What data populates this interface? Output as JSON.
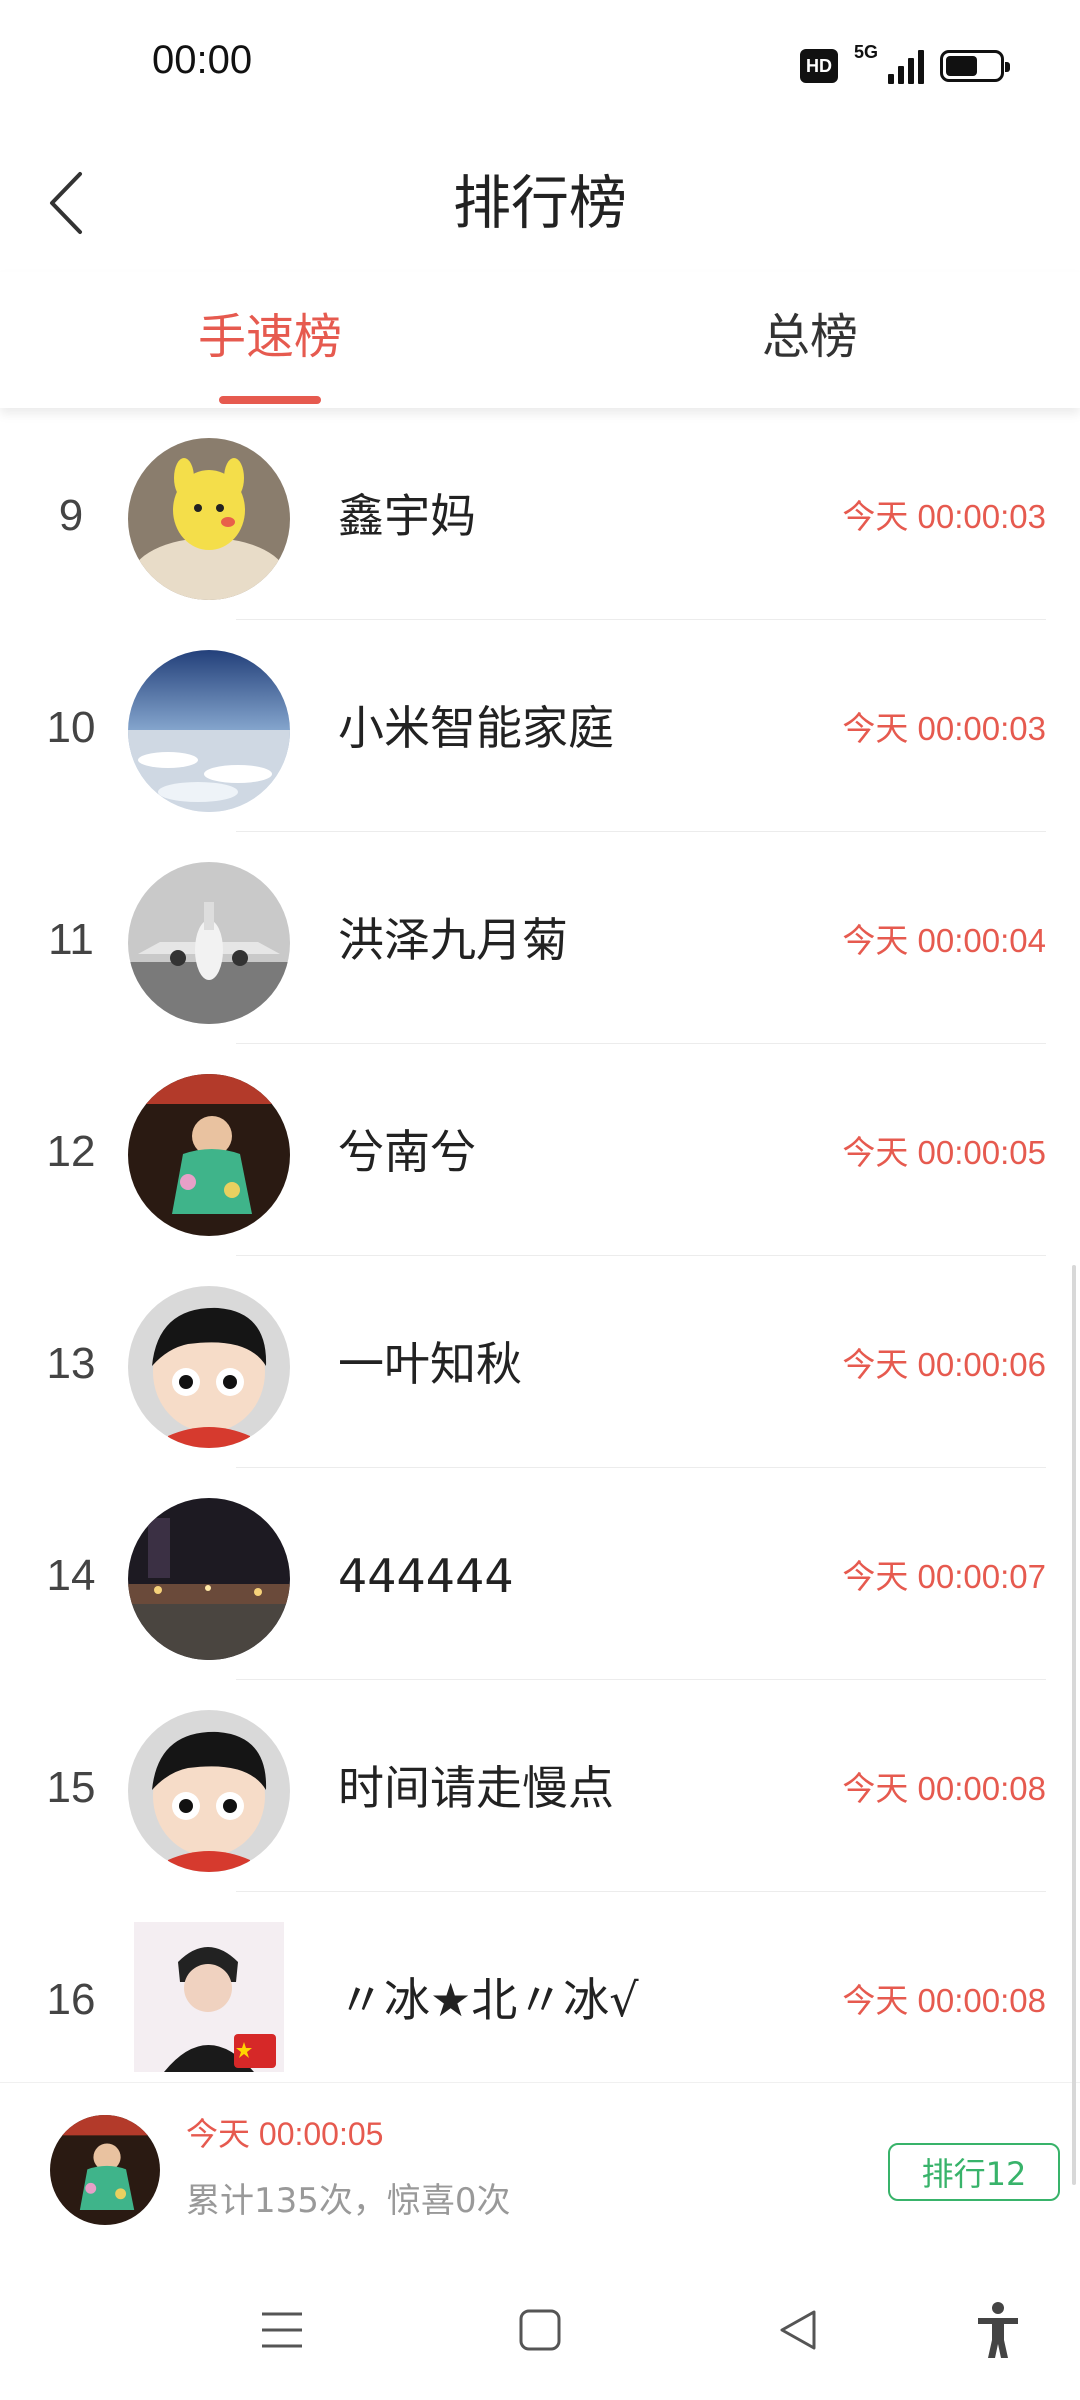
{
  "status_bar": {
    "time": "00:00",
    "hd": "HD",
    "network": "5G",
    "battery_level": 0.6
  },
  "header": {
    "title": "排行榜"
  },
  "tabs": [
    {
      "label": "手速榜",
      "active": true
    },
    {
      "label": "总榜",
      "active": false
    }
  ],
  "rows": [
    {
      "rank": "9",
      "name": "鑫宇妈",
      "time": "今天 00:00:03",
      "avatar": "yellow-character"
    },
    {
      "rank": "10",
      "name": "小米智能家庭",
      "time": "今天 00:00:03",
      "avatar": "earth-horizon"
    },
    {
      "rank": "11",
      "name": "洪泽九月菊",
      "time": "今天 00:00:04",
      "avatar": "aircraft-photo"
    },
    {
      "rank": "12",
      "name": "兮南兮",
      "time": "今天 00:00:05",
      "avatar": "child-stage"
    },
    {
      "rank": "13",
      "name": "一叶知秋",
      "time": "今天 00:00:06",
      "avatar": "default-cartoon"
    },
    {
      "rank": "14",
      "name": "444444",
      "time": "今天 00:00:07",
      "avatar": "night-street"
    },
    {
      "rank": "15",
      "name": "时间请走慢点",
      "time": "今天 00:00:08",
      "avatar": "default-cartoon"
    },
    {
      "rank": "16",
      "name": "〃冰★北〃冰√",
      "time": "今天 00:00:08",
      "avatar": "person-portrait"
    }
  ],
  "my_rank": {
    "time": "今天 00:00:05",
    "stats": "累计135次，惊喜0次",
    "badge": "排行12"
  },
  "nav": {
    "icons": [
      "menu-icon",
      "home-square-icon",
      "back-triangle-icon",
      "accessibility-icon"
    ]
  },
  "colors": {
    "accent": "#e65a4f",
    "badge_green": "#38b36a"
  }
}
